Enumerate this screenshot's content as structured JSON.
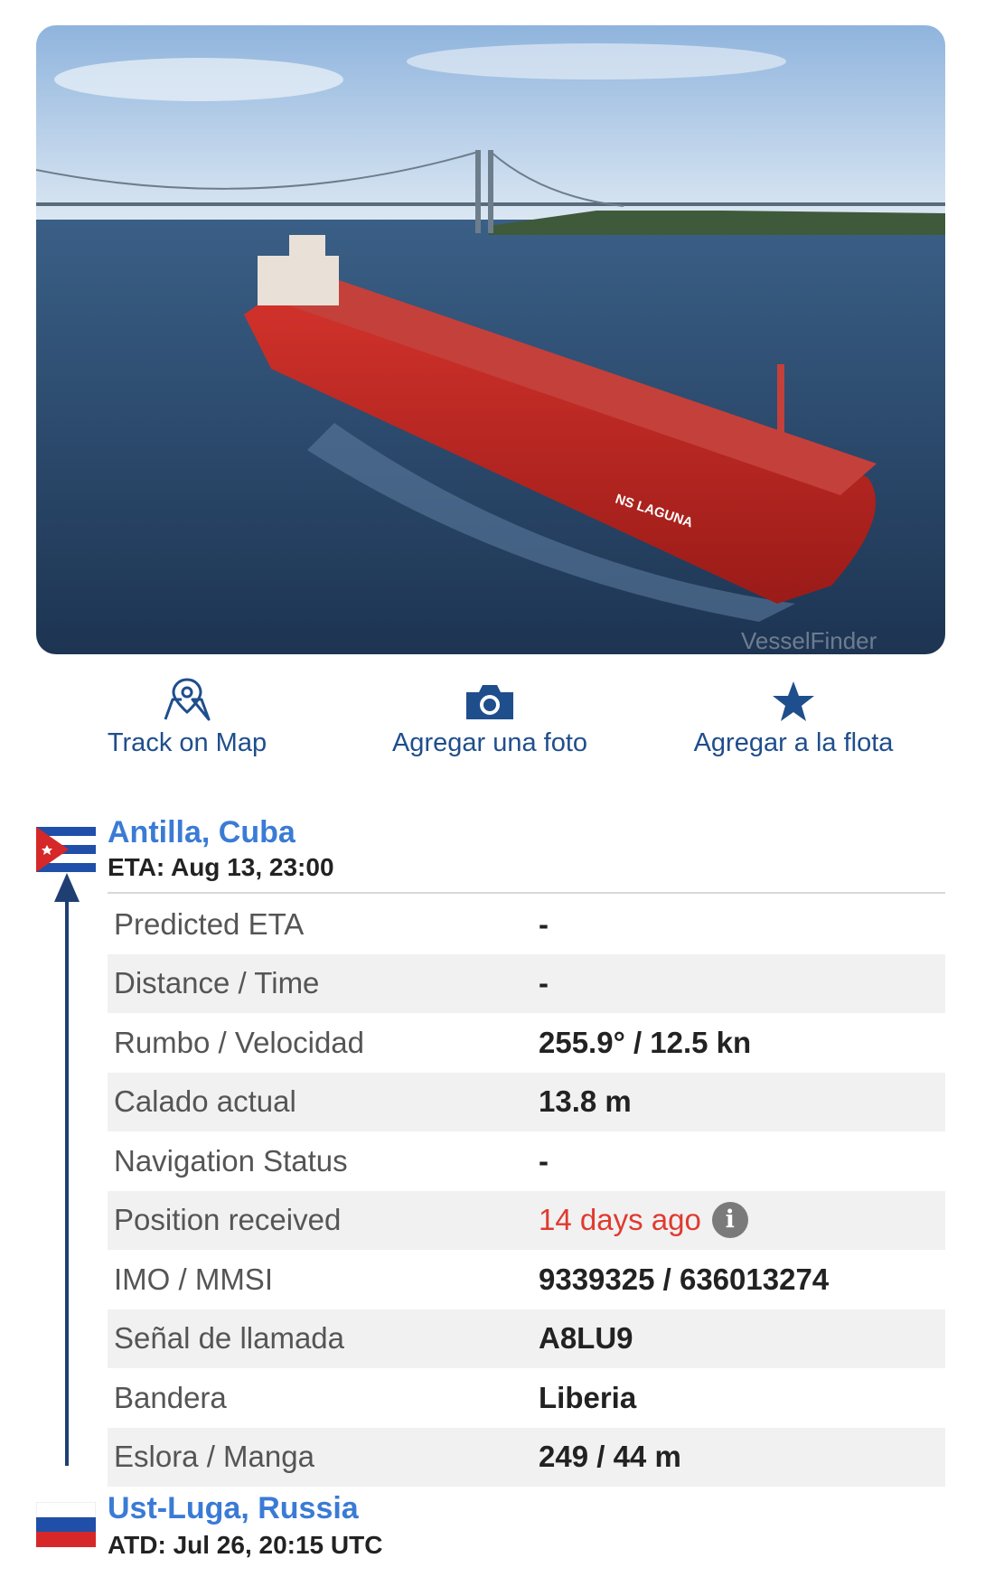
{
  "actions": [
    {
      "label": "Track on Map",
      "icon": "map-pin-icon"
    },
    {
      "label": "Agregar una foto",
      "icon": "camera-icon"
    },
    {
      "label": "Agregar a la flota",
      "icon": "star-icon"
    }
  ],
  "photo": {
    "ship_name_painted": "NS LAGUNA",
    "watermark": "VesselFinder"
  },
  "destination": {
    "port": "Antilla, Cuba",
    "eta": "ETA: Aug 13, 23:00",
    "flag": "cuba-flag"
  },
  "origin": {
    "port": "Ust-Luga, Russia",
    "atd": "ATD: Jul 26, 20:15 UTC",
    "flag": "russia-flag"
  },
  "details": [
    {
      "label": "Predicted ETA",
      "value": "-"
    },
    {
      "label": "Distance / Time",
      "value": "-"
    },
    {
      "label": "Rumbo / Velocidad",
      "value": "255.9° / 12.5 kn"
    },
    {
      "label": "Calado actual",
      "value": "13.8 m"
    },
    {
      "label": "Navigation Status",
      "value": "-"
    },
    {
      "label": "Position received",
      "value": "14 days ago"
    },
    {
      "label": "IMO / MMSI",
      "value": "9339325 / 636013274"
    },
    {
      "label": "Señal de llamada",
      "value": "A8LU9"
    },
    {
      "label": "Bandera",
      "value": "Liberia"
    },
    {
      "label": "Eslora / Manga",
      "value": "249 / 44 m"
    }
  ],
  "colors": {
    "link": "#3a7bd5",
    "icon": "#1f4e8c",
    "route": "#1f3f73",
    "alert": "#e03a2f"
  }
}
